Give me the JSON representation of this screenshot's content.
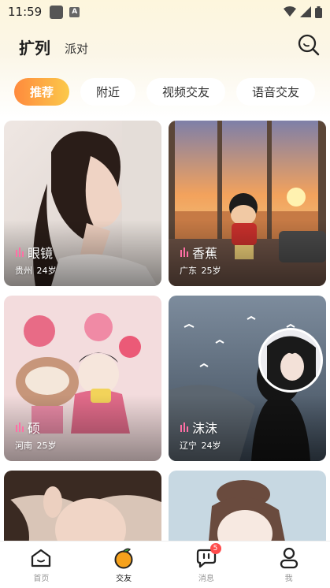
{
  "status_bar": {
    "time": "11:59"
  },
  "header": {
    "tabs": [
      "扩列",
      "派对"
    ]
  },
  "chips": [
    "推荐",
    "附近",
    "视频交友",
    "语音交友"
  ],
  "cards": [
    {
      "name": "眼镜",
      "location": "贵州",
      "age": "24岁"
    },
    {
      "name": "香蕉",
      "location": "广东",
      "age": "25岁"
    },
    {
      "name": "硕",
      "location": "河南",
      "age": "25岁"
    },
    {
      "name": "沫沫",
      "location": "辽宁",
      "age": "24岁"
    }
  ],
  "bottom_nav": [
    {
      "label": "首页",
      "icon": "home-icon"
    },
    {
      "label": "交友",
      "icon": "orange-icon"
    },
    {
      "label": "消息",
      "icon": "message-icon",
      "badge": "5"
    },
    {
      "label": "我",
      "icon": "profile-icon"
    }
  ],
  "colors": {
    "accent_start": "#ff8a3d",
    "accent_end": "#fbc94a",
    "badge": "#ff4b4b",
    "live_icon": "#ff6fa5"
  }
}
